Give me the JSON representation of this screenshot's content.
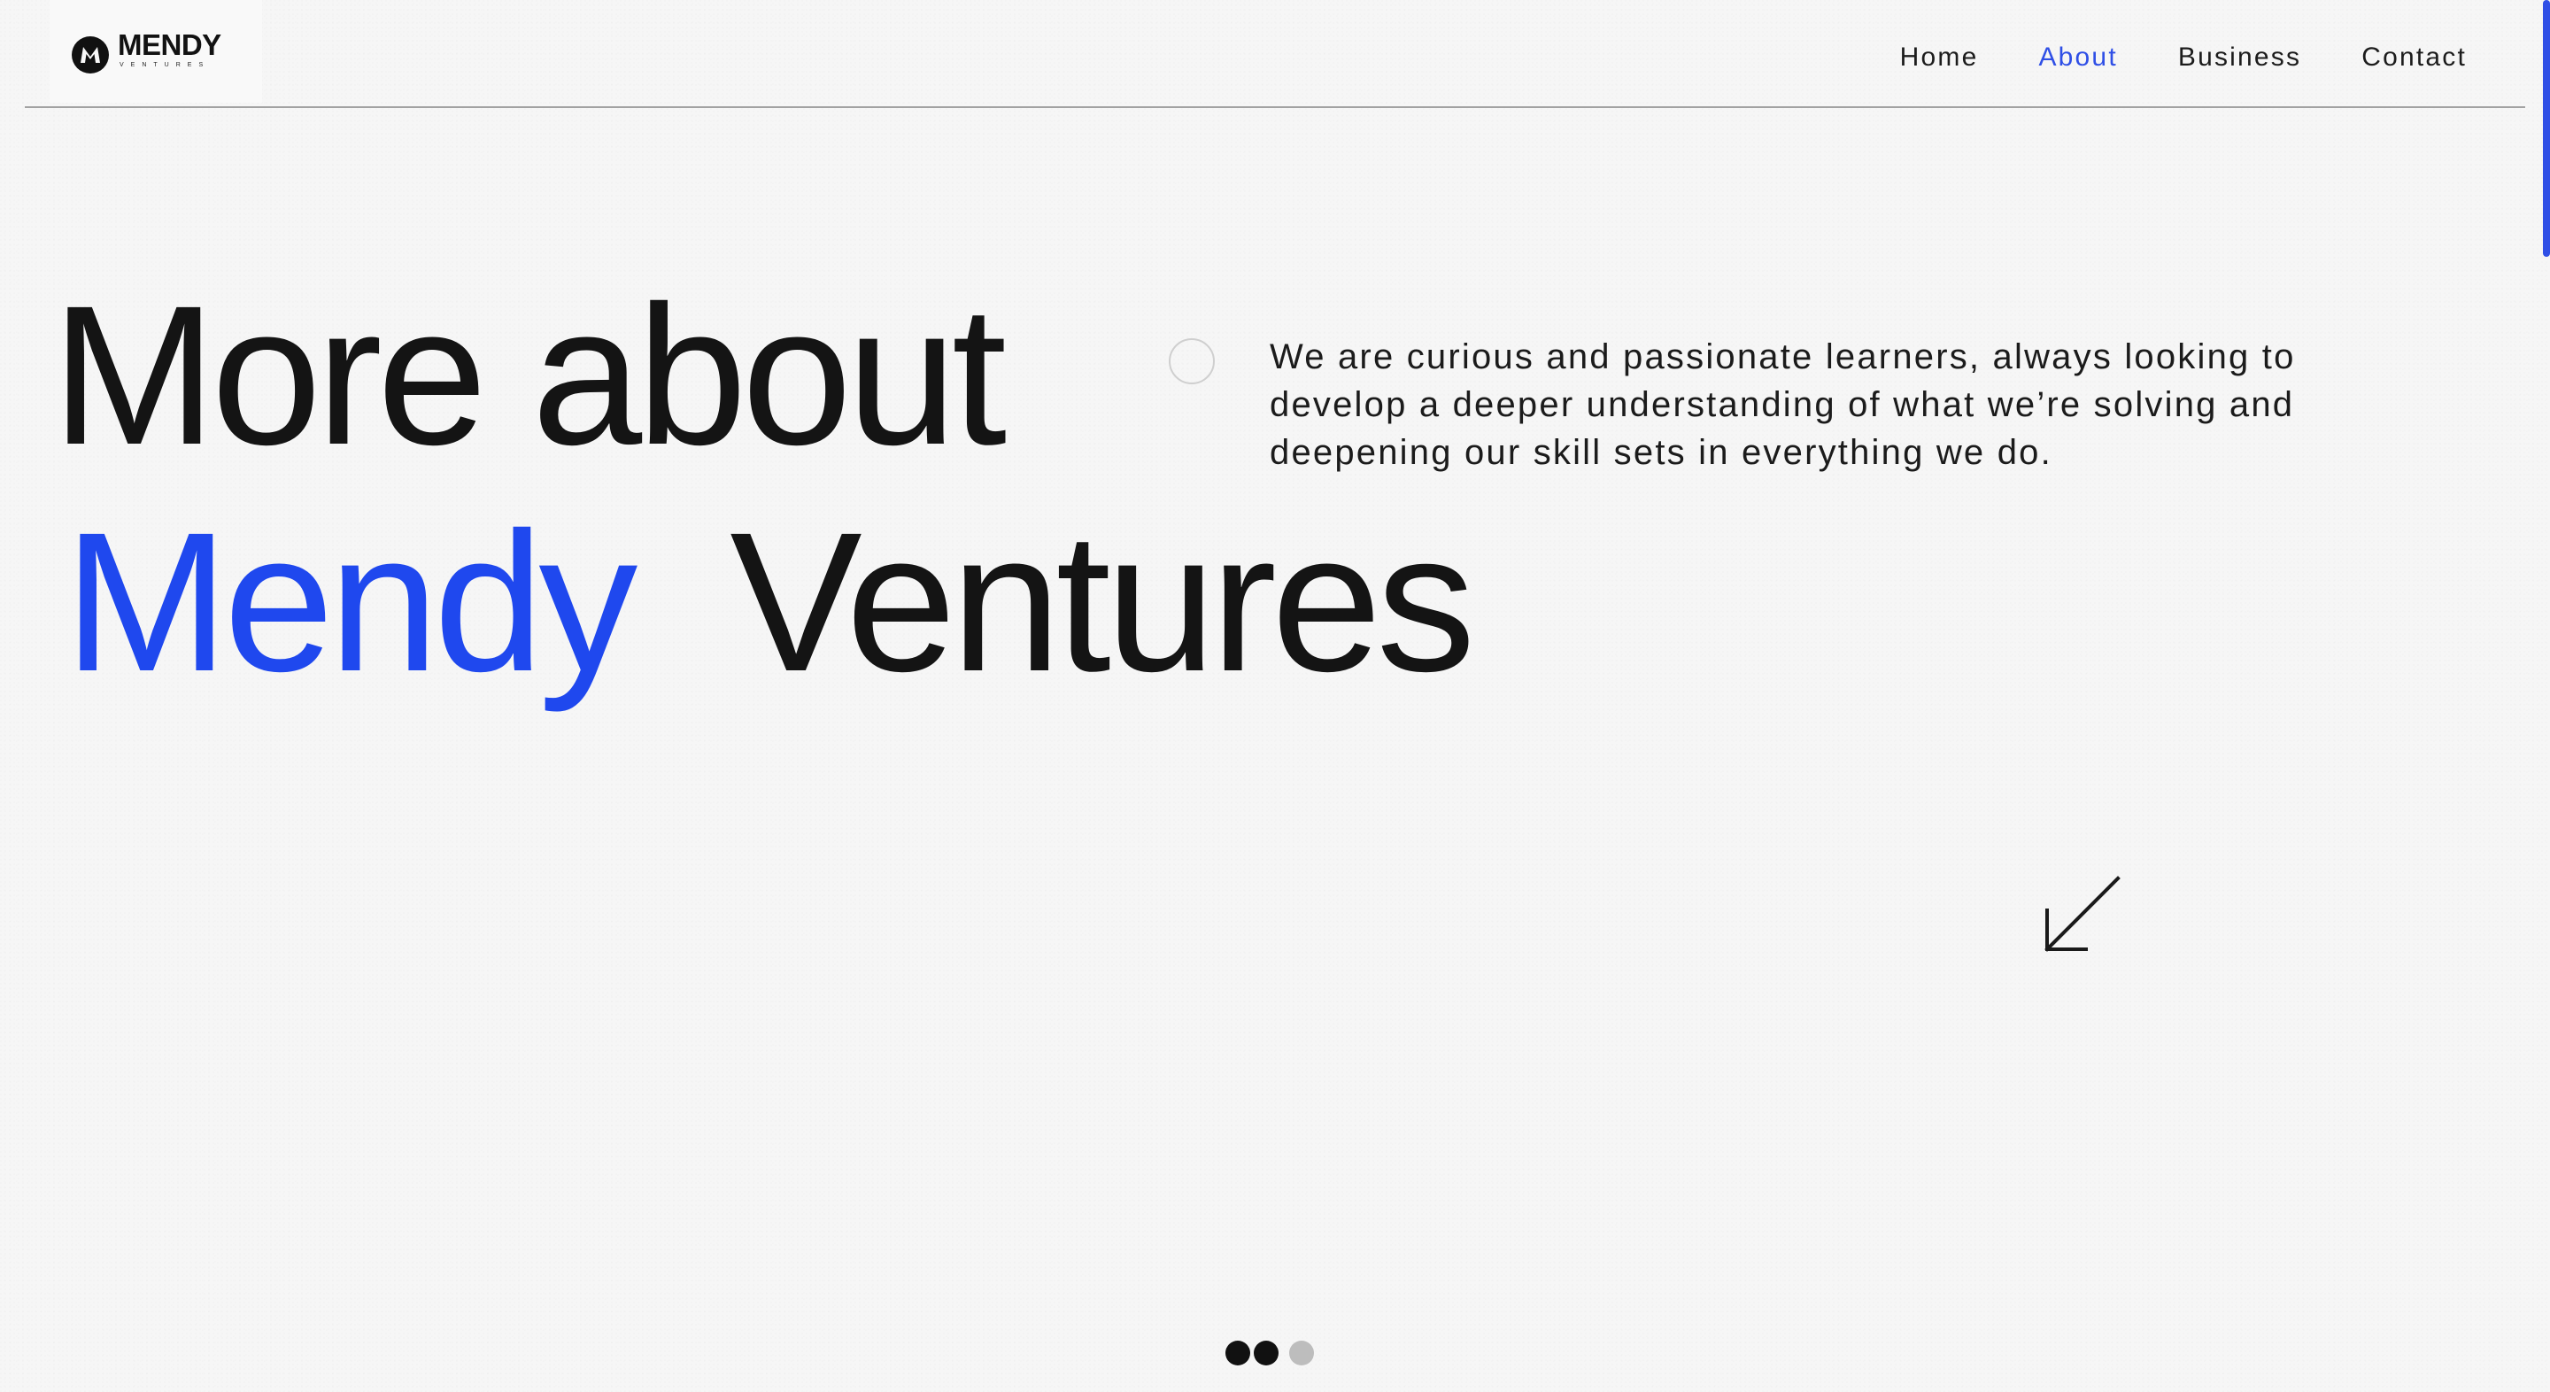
{
  "brand": {
    "name": "MENDY",
    "subtitle": "VENTURES",
    "logo_mark": "M",
    "accent_color": "#1f48ee"
  },
  "nav": {
    "items": [
      {
        "label": "Home",
        "active": false
      },
      {
        "label": "About",
        "active": true
      },
      {
        "label": "Business",
        "active": false
      },
      {
        "label": "Contact",
        "active": false
      }
    ]
  },
  "hero": {
    "line1": "More about",
    "line2_accent": "Mendy",
    "line2_rest": "Ventures",
    "description": "We are curious and passionate learners, always looking to develop a deeper understanding of what we’re solving and deepening our skill sets in everything we do."
  },
  "icons": {
    "scroll_arrow": "arrow-down-left-icon",
    "decorative_circle": "circle-outline-icon"
  },
  "pagination": {
    "total": 3,
    "current": 2
  }
}
